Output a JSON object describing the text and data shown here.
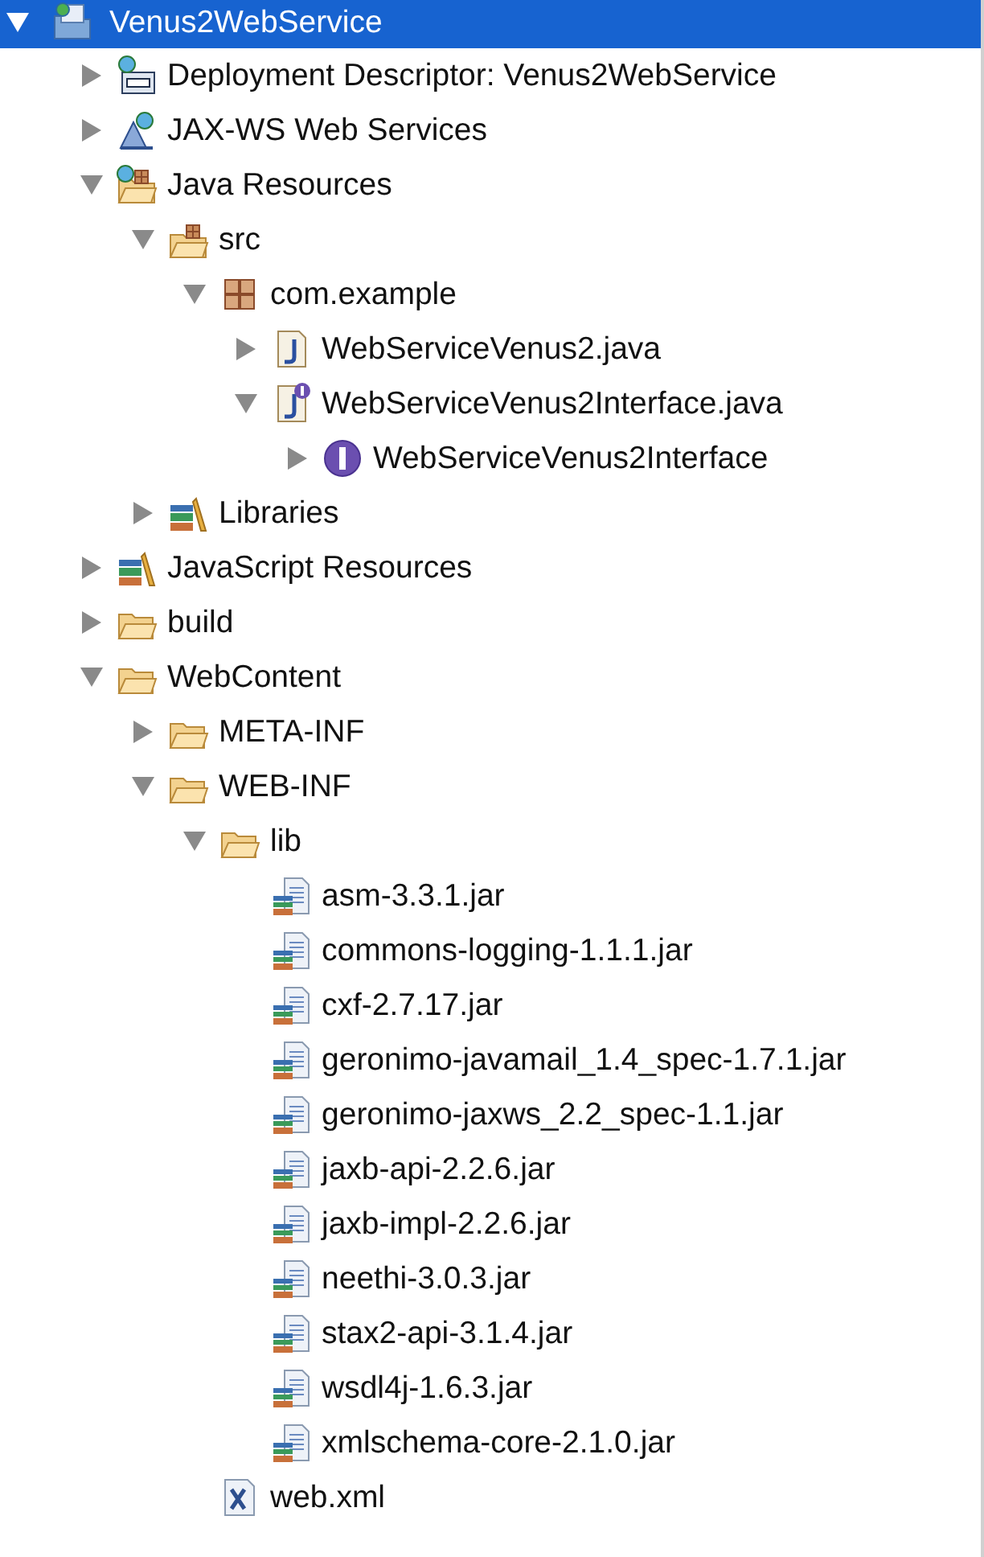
{
  "tree": [
    {
      "label": "Venus2WebService",
      "kind": "project",
      "expanded": true,
      "selected": true,
      "children": [
        {
          "label": "Deployment Descriptor: Venus2WebService",
          "kind": "descriptor",
          "expanded": false,
          "selected": false
        },
        {
          "label": "JAX-WS Web Services",
          "kind": "webservices",
          "expanded": false,
          "selected": false
        },
        {
          "label": "Java Resources",
          "kind": "resources",
          "expanded": true,
          "selected": false,
          "children": [
            {
              "label": "src",
              "kind": "source-folder",
              "expanded": true,
              "selected": false,
              "children": [
                {
                  "label": "com.example",
                  "kind": "package",
                  "expanded": true,
                  "selected": false,
                  "children": [
                    {
                      "label": "WebServiceVenus2.java",
                      "kind": "java",
                      "expanded": false,
                      "selected": false
                    },
                    {
                      "label": "WebServiceVenus2Interface.java",
                      "kind": "java-interface",
                      "expanded": true,
                      "selected": false,
                      "children": [
                        {
                          "label": "WebServiceVenus2Interface",
                          "kind": "interface",
                          "expanded": false,
                          "selected": false
                        }
                      ]
                    }
                  ]
                }
              ]
            },
            {
              "label": "Libraries",
              "kind": "library",
              "expanded": false,
              "selected": false
            }
          ]
        },
        {
          "label": "JavaScript Resources",
          "kind": "library",
          "expanded": false,
          "selected": false
        },
        {
          "label": "build",
          "kind": "folder",
          "expanded": false,
          "selected": false
        },
        {
          "label": "WebContent",
          "kind": "folder",
          "expanded": true,
          "selected": false,
          "children": [
            {
              "label": "META-INF",
              "kind": "folder",
              "expanded": false,
              "selected": false
            },
            {
              "label": "WEB-INF",
              "kind": "folder",
              "expanded": true,
              "selected": false,
              "children": [
                {
                  "label": "lib",
                  "kind": "folder",
                  "expanded": true,
                  "selected": false,
                  "children": [
                    {
                      "label": "asm-3.3.1.jar",
                      "kind": "jar",
                      "selected": false
                    },
                    {
                      "label": "commons-logging-1.1.1.jar",
                      "kind": "jar",
                      "selected": false
                    },
                    {
                      "label": "cxf-2.7.17.jar",
                      "kind": "jar",
                      "selected": false
                    },
                    {
                      "label": "geronimo-javamail_1.4_spec-1.7.1.jar",
                      "kind": "jar",
                      "selected": false
                    },
                    {
                      "label": "geronimo-jaxws_2.2_spec-1.1.jar",
                      "kind": "jar",
                      "selected": false
                    },
                    {
                      "label": "jaxb-api-2.2.6.jar",
                      "kind": "jar",
                      "selected": false
                    },
                    {
                      "label": "jaxb-impl-2.2.6.jar",
                      "kind": "jar",
                      "selected": false
                    },
                    {
                      "label": "neethi-3.0.3.jar",
                      "kind": "jar",
                      "selected": false
                    },
                    {
                      "label": "stax2-api-3.1.4.jar",
                      "kind": "jar",
                      "selected": false
                    },
                    {
                      "label": "wsdl4j-1.6.3.jar",
                      "kind": "jar",
                      "selected": false
                    },
                    {
                      "label": "xmlschema-core-2.1.0.jar",
                      "kind": "jar",
                      "selected": false
                    }
                  ]
                },
                {
                  "label": "web.xml",
                  "kind": "xml",
                  "selected": false
                }
              ]
            }
          ]
        }
      ]
    }
  ]
}
